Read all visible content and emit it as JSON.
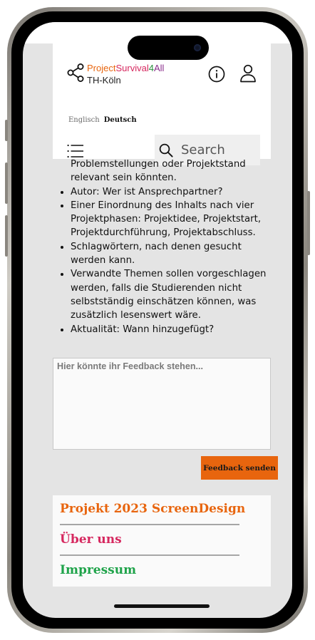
{
  "header": {
    "logo": {
      "part1": "Project",
      "part2": "Survival",
      "part3": "4",
      "part4": "All",
      "subtitle": "TH-Köln",
      "colors": {
        "project": "#e8650e",
        "survival": "#d6285f",
        "four": "#2a8f3e",
        "all": "#8a2e8c"
      }
    },
    "icons": [
      "share-icon",
      "info-icon",
      "user-icon",
      "menu-icon",
      "search-icon"
    ],
    "languages": {
      "en": "Englisch",
      "de": "Deutsch",
      "active": "Deutsch"
    },
    "search": {
      "placeholder": "Search"
    }
  },
  "content": {
    "continuation": "Problemstellungen oder Projektstand relevant sein könnten.",
    "bullets": [
      "Autor: Wer ist Ansprechpartner?",
      "Einer Einordnung des Inhalts nach vier Projektphasen: Projektidee, Projektstart, Projektdurchführung, Projektabschluss.",
      "Schlagwörtern, nach denen gesucht werden kann.",
      "Verwandte Themen sollen vorgeschlagen werden, falls die Studierenden nicht selbstständig einschätzen können, was zusätzlich lesenswert wäre.",
      "Aktualität: Wann hinzugefügt?"
    ]
  },
  "feedback": {
    "placeholder": "Hier könnte ihr Feedback stehen...",
    "send_label": "Feedback senden",
    "accent": "#e8650e"
  },
  "footer": {
    "links": [
      {
        "label": "Projekt 2023 ScreenDesign",
        "color": "#e8650e"
      },
      {
        "label": "Über uns",
        "color": "#d6285f"
      },
      {
        "label": "Impressum",
        "color": "#1fa34a"
      }
    ]
  }
}
